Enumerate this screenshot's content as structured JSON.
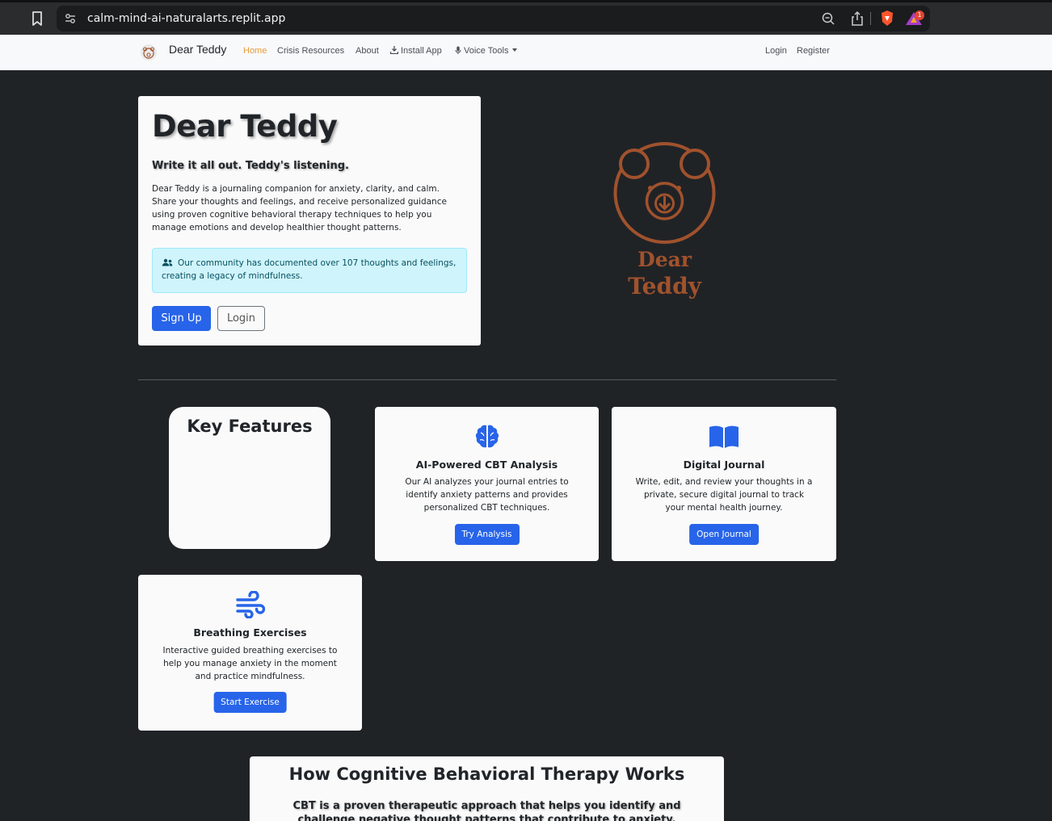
{
  "browser": {
    "url": "calm-mind-ai-naturalarts.replit.app",
    "notification_count": "1"
  },
  "nav": {
    "brand": "Dear Teddy",
    "links": [
      "Home",
      "Crisis Resources",
      "About",
      "Install App",
      "Voice Tools"
    ],
    "right_links": [
      "Login",
      "Register"
    ],
    "active_color": "#e89a3c"
  },
  "hero": {
    "title": "Dear Teddy",
    "tagline": "Write it all out. Teddy's listening.",
    "description": "Dear Teddy is a journaling companion for anxiety, clarity, and calm. Share your thoughts and feelings, and receive personalized guidance using proven cognitive behavioral therapy techniques to help you manage emotions and develop healthier thought patterns.",
    "community_note": "Our community has documented over 107 thoughts and feelings, creating a legacy of mindfulness.",
    "signup_label": "Sign Up",
    "login_label": "Login"
  },
  "logo": {
    "line1": "Dear",
    "line2": "Teddy",
    "color": "#a0522d"
  },
  "features": {
    "heading": "Key Features",
    "cards": [
      {
        "icon": "brain-icon",
        "title": "AI-Powered CBT Analysis",
        "text": "Our AI analyzes your journal entries to identify anxiety patterns and provides personalized CBT techniques.",
        "button": "Try Analysis"
      },
      {
        "icon": "book-open-icon",
        "title": "Digital Journal",
        "text": "Write, edit, and review your thoughts in a private, secure digital journal to track your mental health journey.",
        "button": "Open Journal"
      },
      {
        "icon": "wind-icon",
        "title": "Breathing Exercises",
        "text": "Interactive guided breathing exercises to help you manage anxiety in the moment and practice mindfulness.",
        "button": "Start Exercise"
      }
    ]
  },
  "cbt": {
    "heading": "How Cognitive Behavioral Therapy Works",
    "intro": "CBT is a proven therapeutic approach that helps you identify and challenge negative thought patterns that contribute to anxiety."
  },
  "colors": {
    "primary": "#2764e9",
    "page_bg": "#202326",
    "info_bg": "#cff4fc"
  }
}
